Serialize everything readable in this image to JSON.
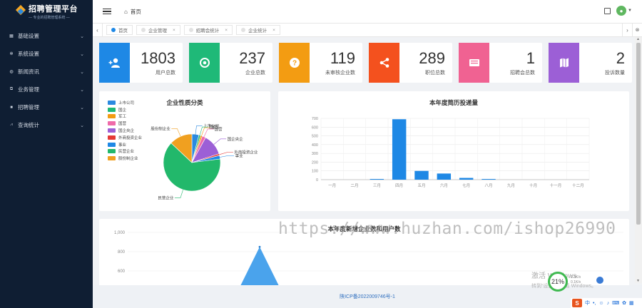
{
  "app": {
    "title": "招聘管理平台",
    "subtitle": "— 专业的招聘管理系统 —"
  },
  "sidebar": {
    "items": [
      {
        "label": "基础设置",
        "icon": "grid-icon"
      },
      {
        "label": "系统设置",
        "icon": "gear-icon"
      },
      {
        "label": "新闻资讯",
        "icon": "globe-icon"
      },
      {
        "label": "业务管理",
        "icon": "briefcase-icon"
      },
      {
        "label": "招聘管理",
        "icon": "user-icon"
      },
      {
        "label": "查询统计",
        "icon": "chart-icon"
      }
    ]
  },
  "header": {
    "breadcrumb": "首页"
  },
  "tabs": [
    {
      "label": "首页",
      "closable": false,
      "active": true
    },
    {
      "label": "企业管理",
      "closable": true,
      "active": false
    },
    {
      "label": "招聘会统计",
      "closable": true,
      "active": false
    },
    {
      "label": "企业统计",
      "closable": true,
      "active": false
    }
  ],
  "stats": [
    {
      "value": "1803",
      "label": "用户总数",
      "color": "#1e88e5",
      "icon": "user-plus-icon"
    },
    {
      "value": "237",
      "label": "企业总数",
      "color": "#1fb978",
      "icon": "target-icon"
    },
    {
      "value": "119",
      "label": "未审核企业数",
      "color": "#f39c12",
      "icon": "question-icon"
    },
    {
      "value": "289",
      "label": "职位总数",
      "color": "#f4511e",
      "icon": "share-icon"
    },
    {
      "value": "1",
      "label": "招聘会总数",
      "color": "#f06292",
      "icon": "book-icon"
    },
    {
      "value": "2",
      "label": "投诉数量",
      "color": "#9c5fd6",
      "icon": "map-icon"
    }
  ],
  "chart_data": [
    {
      "type": "pie",
      "title": "企业性质分类",
      "categories": [
        "上市公司",
        "国企",
        "军工",
        "国营",
        "国企央企",
        "外商投资企业",
        "事业",
        "民营企业",
        "股份制企业"
      ],
      "values": [
        4,
        1,
        1,
        2,
        12,
        1,
        2,
        64,
        13
      ],
      "colors": [
        "#2b8ae0",
        "#1fb978",
        "#f39c12",
        "#ef6aa9",
        "#9c5fd6",
        "#e53935",
        "#1e88e5",
        "#22b86b",
        "#f0a020"
      ],
      "legend": "left"
    },
    {
      "type": "bar",
      "title": "本年度简历投递量",
      "categories": [
        "一月",
        "二月",
        "三月",
        "四月",
        "五月",
        "六月",
        "七月",
        "八月",
        "九月",
        "十月",
        "十一月",
        "十二月"
      ],
      "values": [
        0,
        0,
        8,
        690,
        100,
        70,
        20,
        8,
        0,
        0,
        0,
        0
      ],
      "ylim": [
        0,
        700
      ],
      "yticks": [
        0,
        100,
        200,
        300,
        400,
        500,
        600,
        700
      ],
      "color": "#1e88e5",
      "grid": true
    },
    {
      "type": "area",
      "title": "本年度新增企业数和用户数",
      "yticks": [
        "1,000",
        "800",
        "600"
      ],
      "peak": 850,
      "color": "#4aa3ec"
    }
  ],
  "footer": {
    "icp": "陕ICP备2022009746号-1"
  },
  "overlay": {
    "watermark": "https://www.huzhan.com/ishop26990",
    "activate_line1": "激活 Windows",
    "activate_line2": "转到“设置”以激活 Windows。",
    "cpu": "21%",
    "net1": "0.3K/s",
    "net2": "0.1K/s",
    "ime_label": "中",
    "ime_brand": "S"
  }
}
